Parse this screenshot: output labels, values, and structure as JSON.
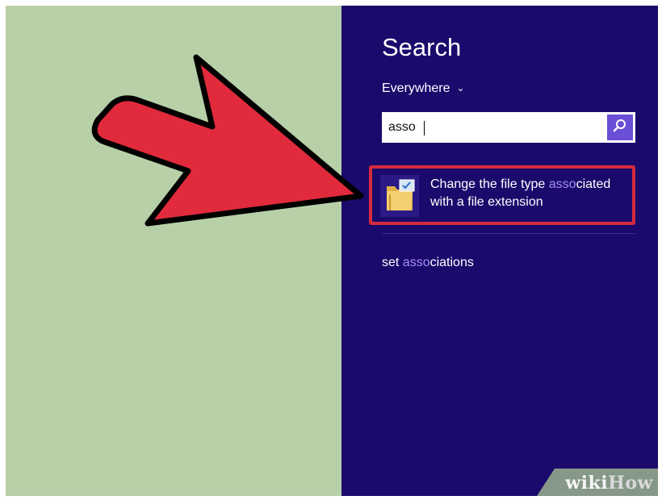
{
  "search_pane": {
    "title": "Search",
    "scope_label": "Everywhere",
    "query": "asso",
    "results": [
      {
        "text_before": "Change the file type ",
        "match": "asso",
        "text_after": "ciated with a file extension"
      }
    ],
    "suggestions": [
      {
        "text_before": "set ",
        "match": "asso",
        "text_after": "ciations"
      }
    ]
  },
  "watermark": {
    "wiki": "wiki",
    "how": "How"
  },
  "colors": {
    "desktop_bg": "#b7d0a8",
    "charm_bg": "#1b0a6c",
    "highlight": "#a38ff2",
    "arrow": "#e12a3b",
    "result_border": "#d52a3e"
  },
  "icons": {
    "scope_chevron": "chevron-down-icon",
    "search_button": "search-icon",
    "result_icon": "folder-icon",
    "arrow": "arrow-right-icon"
  }
}
